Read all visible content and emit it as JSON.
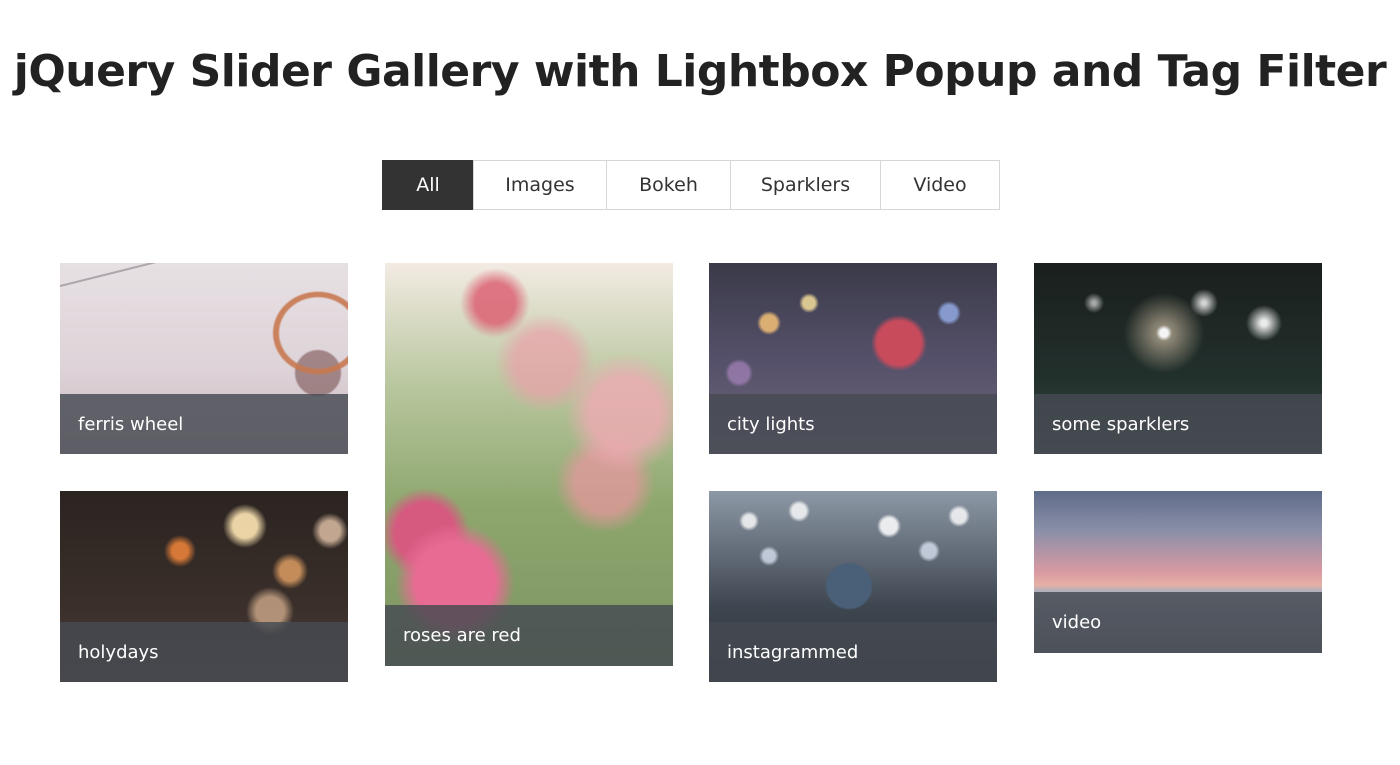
{
  "page": {
    "title": "jQuery Slider Gallery with Lightbox Popup and Tag Filter"
  },
  "filters": {
    "active": "All",
    "items": [
      {
        "label": "All"
      },
      {
        "label": "Images"
      },
      {
        "label": "Bokeh"
      },
      {
        "label": "Sparklers"
      },
      {
        "label": "Video"
      }
    ]
  },
  "gallery": {
    "items": [
      {
        "caption": "ferris wheel"
      },
      {
        "caption": "roses are red"
      },
      {
        "caption": "city lights"
      },
      {
        "caption": "some sparklers"
      },
      {
        "caption": "holydays"
      },
      {
        "caption": "instagrammed"
      },
      {
        "caption": "video"
      }
    ]
  },
  "colors": {
    "active_filter_bg": "#333333",
    "caption_overlay": "#464a52"
  }
}
